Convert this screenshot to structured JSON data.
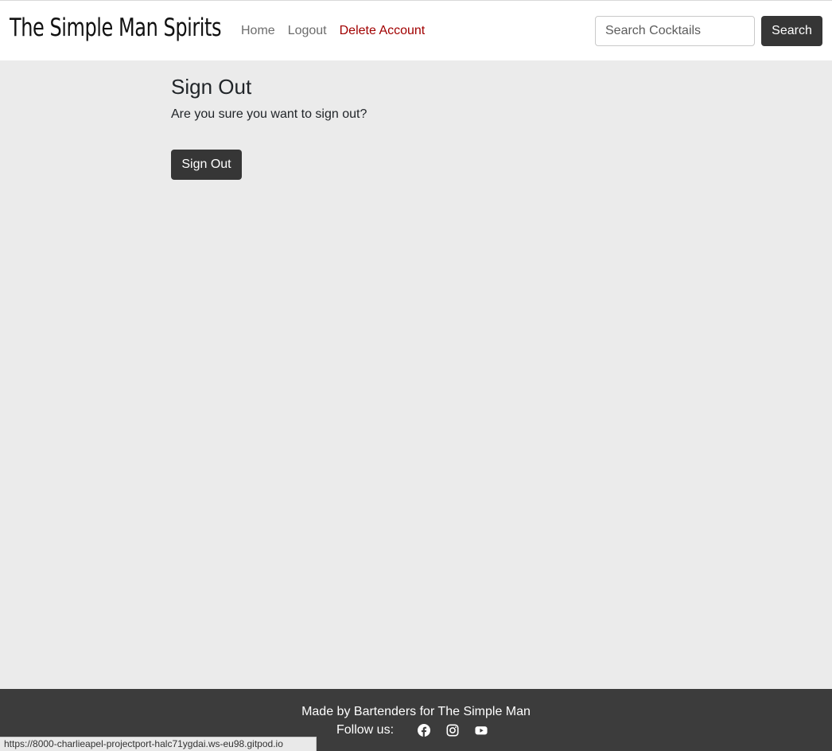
{
  "navbar": {
    "brand": "The Simple Man Spirits",
    "links": [
      {
        "label": "Home"
      },
      {
        "label": "Logout"
      },
      {
        "label": "Delete Account"
      }
    ],
    "search": {
      "placeholder": "Search Cocktails",
      "value": "",
      "button_label": "Search"
    }
  },
  "main": {
    "title": "Sign Out",
    "message": "Are you sure you want to sign out?",
    "button_label": "Sign Out"
  },
  "footer": {
    "credit": "Made by Bartenders for The Simple Man",
    "follow_label": "Follow us:",
    "social_icons": [
      "facebook-icon",
      "instagram-icon",
      "youtube-icon"
    ]
  },
  "status_bar": {
    "url": "https://8000-charlieapel-projectport-halc71ygdai.ws-eu98.gitpod.io"
  },
  "colors": {
    "background": "#ebebeb",
    "navbar": "#ffffff",
    "button": "#363636",
    "danger_link": "#a10000",
    "footer": "#3c3c3c"
  }
}
